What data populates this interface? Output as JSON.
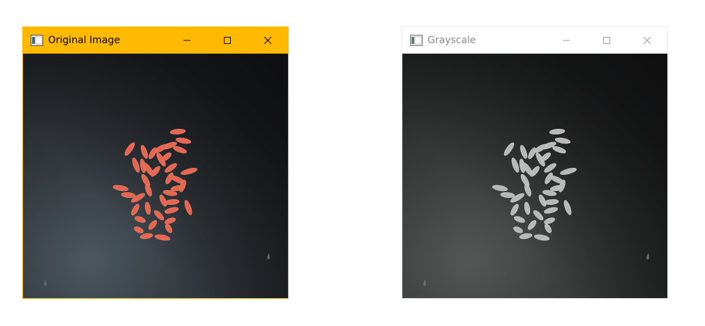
{
  "windows": [
    {
      "title": "Original Image",
      "active": true,
      "titlebar_color": "#FFB900",
      "icon": "app-window-icon",
      "controls": [
        "minimize-icon",
        "maximize-icon",
        "close-icon"
      ],
      "content": "rice-grains-color"
    },
    {
      "title": "Grayscale",
      "active": false,
      "titlebar_color": "#FFFFFF",
      "icon": "app-window-icon",
      "controls": [
        "minimize-icon",
        "maximize-icon",
        "close-icon"
      ],
      "content": "rice-grains-grayscale"
    }
  ],
  "colors": {
    "grain_color": "#E8654F",
    "grain_gray": "#B8B8B8"
  }
}
